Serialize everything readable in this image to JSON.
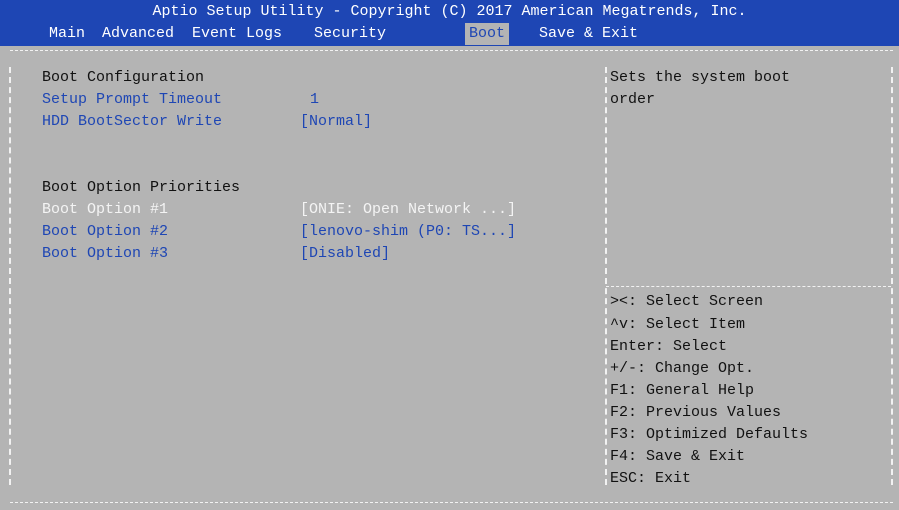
{
  "header": {
    "title": "Aptio Setup Utility - Copyright (C) 2017 American Megatrends, Inc.",
    "tabs": [
      {
        "label": "Main"
      },
      {
        "label": "Advanced"
      },
      {
        "label": "Event Logs"
      },
      {
        "label": "Security"
      },
      {
        "label": "Boot"
      },
      {
        "label": "Save & Exit"
      }
    ],
    "active_tab": "Boot"
  },
  "main": {
    "section1": "Boot Configuration",
    "settings": [
      {
        "label": "Setup Prompt Timeout",
        "value": "1"
      },
      {
        "label": "HDD BootSector Write",
        "value": "[Normal]"
      }
    ],
    "section2": "Boot Option Priorities",
    "boot_options": [
      {
        "label": "Boot Option #1",
        "value": "[ONIE: Open Network ...]",
        "selected": true
      },
      {
        "label": "Boot Option #2",
        "value": "[lenovo-shim (P0: TS...]",
        "selected": false
      },
      {
        "label": "Boot Option #3",
        "value": "[Disabled]",
        "selected": false
      }
    ]
  },
  "help": {
    "description_line1": "Sets the system boot",
    "description_line2": "order",
    "keys": [
      "><: Select Screen",
      "^v: Select Item",
      "Enter: Select",
      "+/-: Change Opt.",
      "F1: General Help",
      "F2: Previous Values",
      "F3: Optimized Defaults",
      "F4: Save & Exit",
      "ESC: Exit"
    ]
  },
  "colors": {
    "header_bg": "#1e46b4",
    "body_bg": "#b4b4b4",
    "highlight_text": "#1e46b4",
    "selected_text": "#f4f4f4"
  }
}
